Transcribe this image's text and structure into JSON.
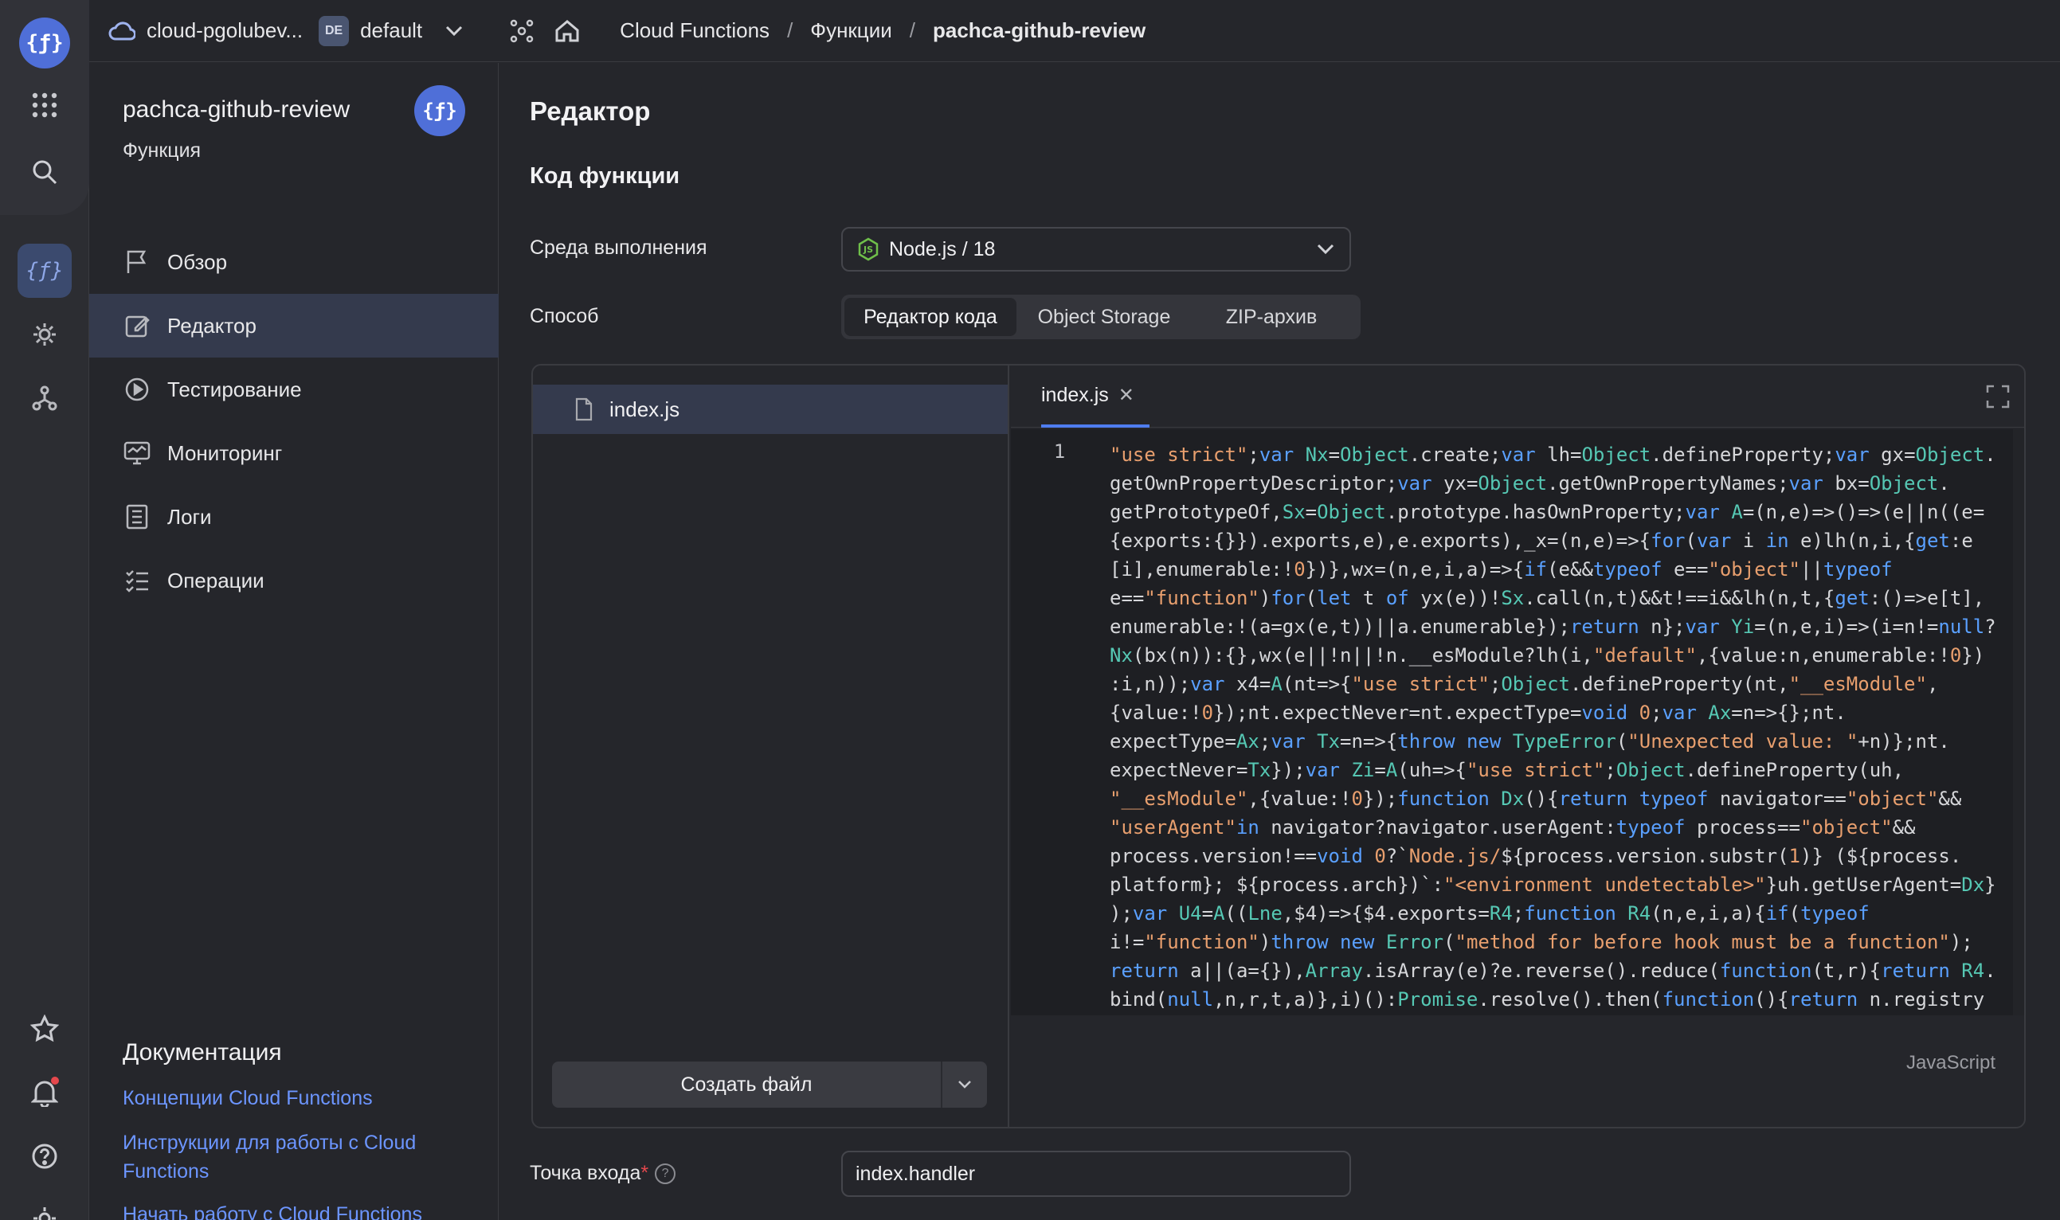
{
  "topbar": {
    "cloud": "cloud-pgolubev...",
    "folder_badge": "DE",
    "folder": "default",
    "breadcrumbs": [
      "Cloud Functions",
      "Функции",
      "pachca-github-review"
    ]
  },
  "rail": {
    "logo": "{ƒ}",
    "icons": [
      "services-grid-icon",
      "search-icon",
      "functions-icon",
      "settings-gear-icon",
      "network-icon",
      "star-icon",
      "bell-icon",
      "help-icon",
      "settings-icon"
    ]
  },
  "sidebar": {
    "title": "pachca-github-review",
    "subtitle": "Функция",
    "badge": "{ƒ}",
    "items": [
      {
        "label": "Обзор",
        "icon": "flag-icon"
      },
      {
        "label": "Редактор",
        "icon": "edit-icon",
        "active": true
      },
      {
        "label": "Тестирование",
        "icon": "play-icon"
      },
      {
        "label": "Мониторинг",
        "icon": "monitor-icon"
      },
      {
        "label": "Логи",
        "icon": "logs-icon"
      },
      {
        "label": "Операции",
        "icon": "operations-icon"
      }
    ],
    "docs_title": "Документация",
    "docs_links": [
      "Концепции Cloud Functions",
      "Инструкции для работы с Cloud Functions",
      "Начать работу с Cloud Functions"
    ]
  },
  "main": {
    "title": "Редактор",
    "section": "Код функции",
    "runtime_label": "Среда выполнения",
    "runtime_value": "Node.js / 18",
    "method_label": "Способ",
    "methods": [
      "Редактор кода",
      "Object Storage",
      "ZIP-архив"
    ],
    "files": [
      "index.js"
    ],
    "create_file": "Создать файл",
    "open_tab": "index.js",
    "line_number": "1",
    "language": "JavaScript",
    "entry_label": "Точка входа",
    "entry_required": "*",
    "entry_value": "index.handler"
  },
  "colors": {
    "accent": "#4f6fd8",
    "link": "#6c95ff",
    "active_bg": "#343a4d",
    "keyword": "#5aa0ff",
    "string": "#e89f6e"
  }
}
